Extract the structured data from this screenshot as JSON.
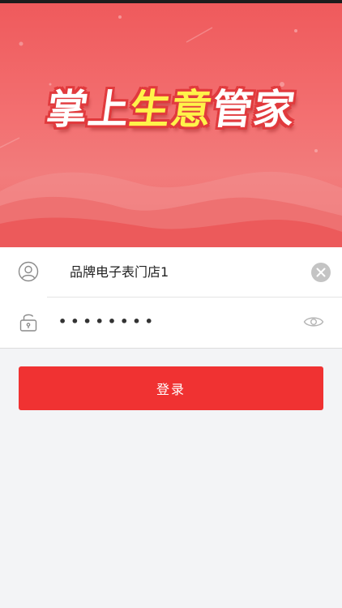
{
  "app": {
    "logo_parts": [
      {
        "text": "掌上",
        "style": "plain"
      },
      {
        "text": "生意",
        "style": "accent"
      },
      {
        "text": "管家",
        "style": "plain"
      }
    ]
  },
  "login_form": {
    "username_value": "品牌电子表门店1",
    "password_masked": "••••••••",
    "submit_label": "登录"
  },
  "icons": {
    "username": "user-icon",
    "password": "lock-icon",
    "clear": "clear-icon",
    "reveal": "eye-icon"
  },
  "colors": {
    "banner_red": "#f06263",
    "logo_yellow": "#fff34a",
    "button_red": "#f03232",
    "page_background": "#f3f4f6"
  }
}
